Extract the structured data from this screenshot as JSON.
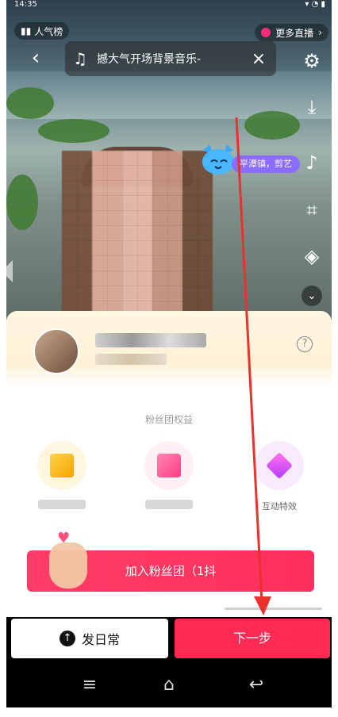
{
  "status": {
    "time": "14:35",
    "right": ""
  },
  "top": {
    "rank_label": "人气榜",
    "more_live_label": "更多直播"
  },
  "music": {
    "title": "撼大气开场背景音乐-"
  },
  "location": {
    "label": "平潭镇，剪艺"
  },
  "sheet": {
    "perks_title": "粉丝团权益",
    "perk3_label": "互动特效",
    "join_label": "加入粉丝团（1抖"
  },
  "actions": {
    "daily_label": "发日常",
    "next_label": "下一步"
  },
  "colors": {
    "accent": "#fe2c55",
    "annotation": "#e8322b",
    "location_pill": "#8a6cff"
  },
  "icons": [
    "back-icon",
    "music-note-icon",
    "close-icon",
    "gear-icon",
    "download-icon",
    "music-icon",
    "crop-icon",
    "tag-icon",
    "chevron-down-icon",
    "help-icon",
    "upload-icon",
    "menu-icon",
    "home-icon",
    "back-nav-icon"
  ]
}
